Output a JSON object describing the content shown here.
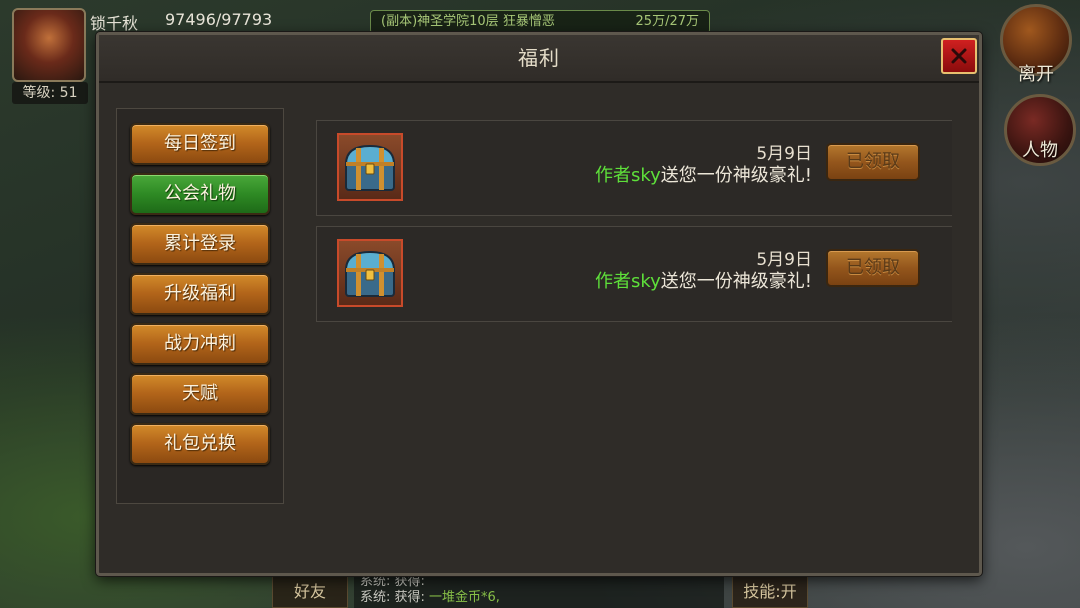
{
  "hud": {
    "player_name": "锁千秋",
    "hp": "97496/97793",
    "level_label": "等级: 51",
    "quest_text": "(副本)神圣学院10层 狂暴憎恶",
    "quest_progress": "25万/27万",
    "leave_label": "离开",
    "character_label": "人物",
    "friends_label": "好友",
    "skill_label": "技能:开",
    "chat_line1_prefix": "系统: 获得: ",
    "chat_line1_item": "",
    "chat_line2_prefix": "系统: 获得: ",
    "chat_line2_item": "一堆金币*6,"
  },
  "dialog": {
    "title": "福利",
    "close_icon": "close-x-icon"
  },
  "sidebar": {
    "items": [
      {
        "label": "每日签到",
        "active": false
      },
      {
        "label": "公会礼物",
        "active": true
      },
      {
        "label": "累计登录",
        "active": false
      },
      {
        "label": "升级福利",
        "active": false
      },
      {
        "label": "战力冲刺",
        "active": false
      },
      {
        "label": "天赋",
        "active": false
      },
      {
        "label": "礼包兑换",
        "active": false
      }
    ]
  },
  "rewards": [
    {
      "icon": "treasure-chest-icon",
      "date": "5月9日",
      "author": "作者sky",
      "message": "送您一份神级豪礼!",
      "button_label": "已领取"
    },
    {
      "icon": "treasure-chest-icon",
      "date": "5月9日",
      "author": "作者sky",
      "message": "送您一份神级豪礼!",
      "button_label": "已领取"
    }
  ],
  "colors": {
    "active_tab": "#2e8a24",
    "tab": "#b2651a",
    "author_text": "#5ee03a",
    "close_button": "#c01818"
  }
}
